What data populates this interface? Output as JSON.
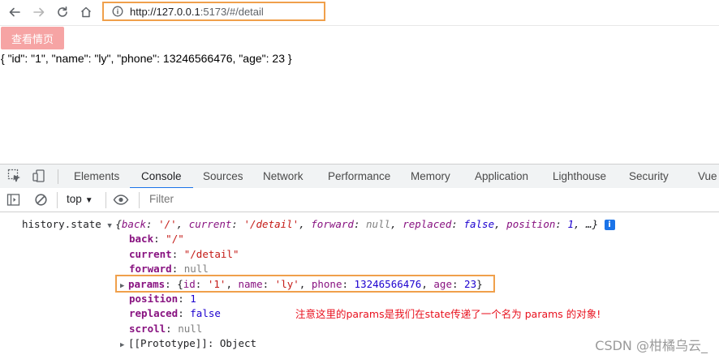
{
  "browser": {
    "url_host": "http://127.0.0.1",
    "url_rest": ":5173/#/detail"
  },
  "page": {
    "button_label": "查看情页",
    "json_text": "{ \"id\": \"1\", \"name\": \"ly\", \"phone\": 13246566476, \"age\": 23 }"
  },
  "devtools": {
    "tabs": [
      "Elements",
      "Console",
      "Sources",
      "Network",
      "Performance",
      "Memory",
      "Application",
      "Lighthouse",
      "Security",
      "Vue"
    ],
    "active_tab": "Console",
    "context": "top",
    "filter_placeholder": "Filter",
    "accent": "#1a73e8"
  },
  "console": {
    "label": "history.state",
    "summary": {
      "k_back": "back",
      "v_back": "'/'",
      "k_current": "current",
      "v_current": "'/detail'",
      "k_forward": "forward",
      "v_forward": "null",
      "k_replaced": "replaced",
      "v_replaced": "false",
      "k_position": "position",
      "v_position": "1",
      "ellipsis": "…"
    },
    "props": {
      "back_key": "back",
      "back_val": "\"/\"",
      "current_key": "current",
      "current_val": "\"/detail\"",
      "forward_key": "forward",
      "forward_val": "null",
      "params_key": "params",
      "params_id_key": "id",
      "params_id_val": "'1'",
      "params_name_key": "name",
      "params_name_val": "'ly'",
      "params_phone_key": "phone",
      "params_phone_val": "13246566476",
      "params_age_key": "age",
      "params_age_val": "23",
      "position_key": "position",
      "position_val": "1",
      "replaced_key": "replaced",
      "replaced_val": "false",
      "scroll_key": "scroll",
      "scroll_val": "null",
      "proto_key": "[[Prototype]]",
      "proto_val": "Object"
    }
  },
  "annotation": "注意这里的params是我们在state传递了一个名为 params 的对象!",
  "watermark": "CSDN @柑橘乌云_",
  "colors": {
    "highlight_box": "#f0a04b",
    "button_bg": "#f6a4a4",
    "note": "#e8111e"
  }
}
